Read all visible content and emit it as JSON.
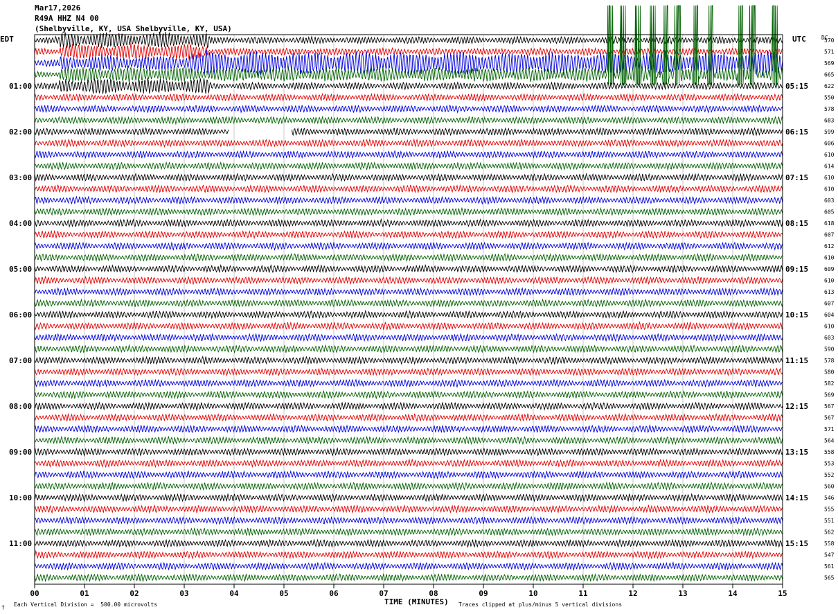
{
  "header": {
    "date": "Mar17,2026",
    "station": "R49A HHZ N4 00",
    "location": "(Shelbyville, KY, USA Shelbyville, KY, USA)"
  },
  "labels": {
    "left_zone": "EDT",
    "right_zone": "UTC",
    "dc_header": "DC",
    "xlabel": "TIME (MINUTES)",
    "scale_note": "Each Vertical Division =  500.00 microvolts",
    "clip_note": "Traces clipped at plus/minus 5 vertical divisions",
    "corner_mark": "†"
  },
  "colors": {
    "trace_cycle": [
      "#000000",
      "#e00000",
      "#0000d8",
      "#006000"
    ],
    "grid": "#c8c8c8",
    "frame": "#000000"
  },
  "chart_data": {
    "type": "line",
    "title": "Mar17,2026  R49A HHZ N4 00  (Shelbyville, KY, USA Shelbyville, KY, USA)",
    "xlabel": "TIME (MINUTES)",
    "xlim": [
      0,
      15
    ],
    "x_ticks": [
      "00",
      "01",
      "02",
      "03",
      "04",
      "05",
      "06",
      "07",
      "08",
      "09",
      "10",
      "11",
      "12",
      "13",
      "14",
      "15"
    ],
    "rows_per_hour": 4,
    "minutes_per_row": 15,
    "left_time_labels": [
      "01:00",
      "02:00",
      "03:00",
      "04:00",
      "05:00",
      "06:00",
      "07:00",
      "08:00",
      "09:00",
      "10:00",
      "11:00"
    ],
    "right_time_labels": [
      "05:15",
      "06:15",
      "07:15",
      "08:15",
      "09:15",
      "10:15",
      "11:15",
      "12:15",
      "13:15",
      "14:15",
      "15:15"
    ],
    "dc_offsets": [
      570,
      571,
      569,
      665,
      622,
      550,
      578,
      683,
      599,
      606,
      610,
      614,
      610,
      610,
      603,
      605,
      618,
      607,
      612,
      610,
      609,
      610,
      613,
      607,
      604,
      610,
      603,
      590,
      578,
      580,
      582,
      569,
      567,
      567,
      571,
      564,
      558,
      553,
      552,
      560,
      546,
      555,
      551,
      562,
      558,
      547,
      561,
      565
    ],
    "gaps": [
      {
        "row": 8,
        "from_min": 3.9,
        "to_min": 5.15
      }
    ],
    "clipped_spikes_row3_min": [
      11.55,
      11.8,
      12.1,
      12.4,
      12.65,
      12.9,
      13.25,
      13.55,
      14.15,
      14.4,
      14.85
    ],
    "scale_microvolts_per_division": 500,
    "clip_divisions": 5
  }
}
